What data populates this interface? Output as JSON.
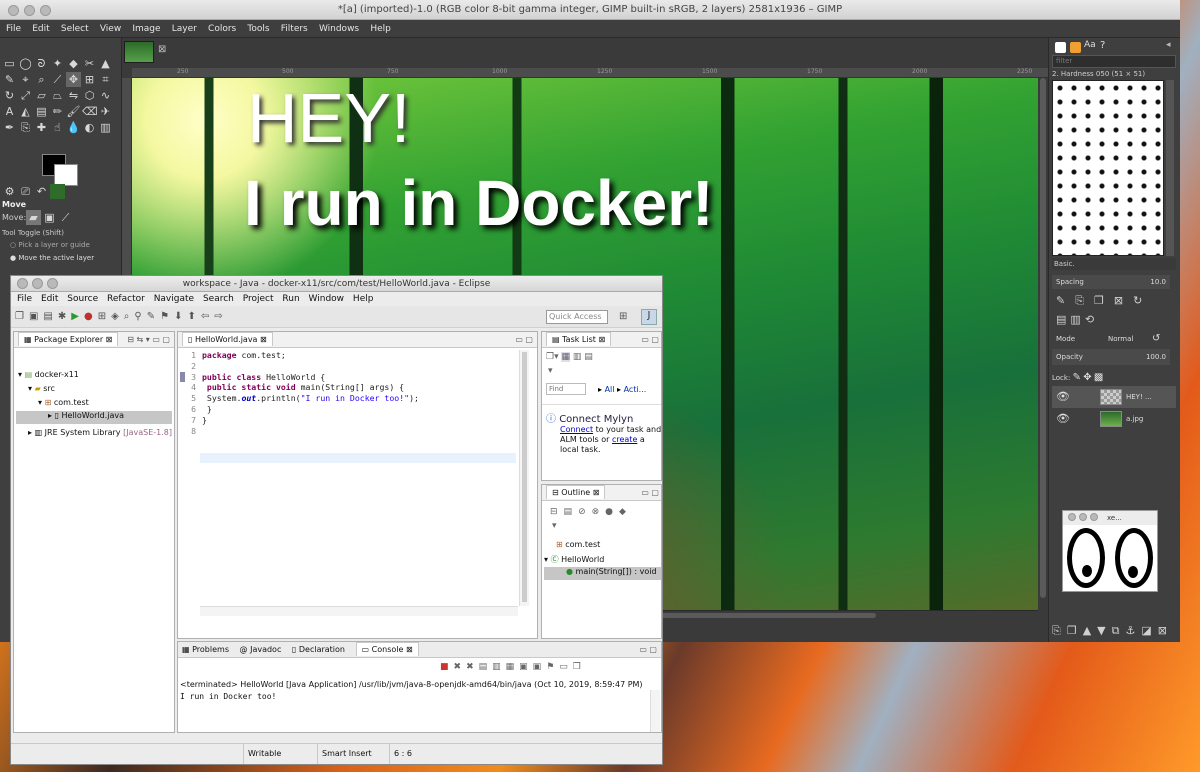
{
  "gimp": {
    "title": "*[a] (imported)-1.0 (RGB color 8-bit gamma integer, GIMP built-in sRGB, 2 layers) 2581x1936 – GIMP",
    "menu": [
      "File",
      "Edit",
      "Select",
      "View",
      "Image",
      "Layer",
      "Colors",
      "Tools",
      "Filters",
      "Windows",
      "Help"
    ],
    "tool_options": {
      "name": "Move",
      "move_label": "Move:",
      "toggle": "Tool Toggle  (Shift)",
      "opt1": "Pick a layer or guide",
      "opt2": "Move the active layer"
    },
    "ruler_ticks": [
      "250",
      "500",
      "750",
      "1000",
      "1250",
      "1500",
      "1750",
      "2000",
      "2250"
    ],
    "image_text": {
      "line1": "HEY!",
      "line2": "I run in Docker!"
    },
    "brushes": {
      "filter_placeholder": "filter",
      "name": "2. Hardness 050 (51 × 51)",
      "preset": "Basic.",
      "spacing_label": "Spacing",
      "spacing_value": "10.0"
    },
    "layers": {
      "mode_label": "Mode",
      "mode_value": "Normal",
      "opacity_label": "Opacity",
      "opacity_value": "100.0",
      "lock_label": "Lock:",
      "items": [
        {
          "name": "HEY! ..."
        },
        {
          "name": "a.jpg"
        }
      ]
    }
  },
  "xeyes": {
    "title": "xe..."
  },
  "eclipse": {
    "title": "workspace - Java - docker-x11/src/com/test/HelloWorld.java - Eclipse",
    "menu": [
      "File",
      "Edit",
      "Source",
      "Refactor",
      "Navigate",
      "Search",
      "Project",
      "Run",
      "Window",
      "Help"
    ],
    "quick_access": "Quick Access",
    "package_explorer": {
      "tab": "Package Explorer",
      "tree": [
        "docker-x11",
        "src",
        "com.test",
        "HelloWorld.java",
        "JRE System Library"
      ],
      "jre_suffix": "[JavaSE-1.8]"
    },
    "editor": {
      "tab": "HelloWorld.java",
      "lines": [
        {
          "n": "1",
          "parts": [
            {
              "t": "package",
              "c": "kw"
            },
            {
              "t": " com.test;",
              "c": ""
            }
          ]
        },
        {
          "n": "2",
          "parts": []
        },
        {
          "n": "3",
          "parts": [
            {
              "t": "public class",
              "c": "kw"
            },
            {
              "t": " HelloWorld {",
              "c": ""
            }
          ]
        },
        {
          "n": "4",
          "parts": [
            {
              "t": "    public static void",
              "c": "kw"
            },
            {
              "t": " main(String[] args) {",
              "c": ""
            }
          ]
        },
        {
          "n": "5",
          "parts": [
            {
              "t": "        System.",
              "c": ""
            },
            {
              "t": "out",
              "c": "it"
            },
            {
              "t": ".println(",
              "c": ""
            },
            {
              "t": "\"I run in Docker too!\"",
              "c": "st"
            },
            {
              "t": ");",
              "c": ""
            }
          ]
        },
        {
          "n": "6",
          "parts": [
            {
              "t": "    }",
              "c": ""
            }
          ]
        },
        {
          "n": "7",
          "parts": [
            {
              "t": "}",
              "c": ""
            }
          ]
        },
        {
          "n": "8",
          "parts": []
        }
      ]
    },
    "task_list": {
      "tab": "Task List",
      "find_placeholder": "Find",
      "all": "All",
      "activate": "Acti...",
      "mylyn_title": "Connect Mylyn",
      "connect": "Connect",
      "mylyn_text1": " to your task and",
      "mylyn_text2": "ALM tools or ",
      "create": "create",
      "mylyn_text3": " a",
      "mylyn_text4": "local task."
    },
    "outline": {
      "tab": "Outline",
      "items": [
        "com.test",
        "HelloWorld",
        "main(String[]) : void"
      ]
    },
    "bottom_tabs": [
      "Problems",
      "Javadoc",
      "Declaration",
      "Console"
    ],
    "console": {
      "terminated": "<terminated> HelloWorld [Java Application] /usr/lib/jvm/java-8-openjdk-amd64/bin/java (Oct 10, 2019, 8:59:47 PM)",
      "output": "I run in Docker too!"
    },
    "status": {
      "writable": "Writable",
      "insert": "Smart Insert",
      "pos": "6 : 6"
    }
  }
}
